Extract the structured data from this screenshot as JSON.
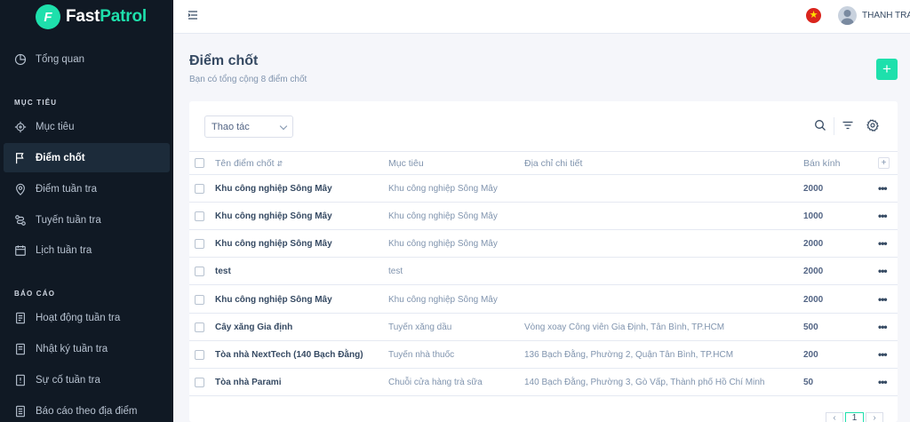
{
  "brand": {
    "name_part1": "Fast",
    "name_part2": "Patrol",
    "logo_letter": "F"
  },
  "sidebar": {
    "items": [
      {
        "label": "Tổng quan",
        "icon": "pie-chart-icon"
      },
      {
        "label": "Mục tiêu",
        "icon": "target-icon"
      },
      {
        "label": "Điểm chốt",
        "icon": "flag-icon",
        "active": true
      },
      {
        "label": "Điểm tuần tra",
        "icon": "map-pin-icon"
      },
      {
        "label": "Tuyến tuần tra",
        "icon": "route-icon"
      },
      {
        "label": "Lịch tuần tra",
        "icon": "calendar-icon"
      },
      {
        "label": "Hoạt động tuần tra",
        "icon": "report-icon"
      },
      {
        "label": "Nhật ký tuần tra",
        "icon": "journal-icon"
      },
      {
        "label": "Sự cố tuần tra",
        "icon": "incident-icon"
      },
      {
        "label": "Báo cáo theo địa điểm",
        "icon": "location-report-icon"
      }
    ],
    "headers": {
      "targets": "MỤC TIÊU",
      "reports": "BÁO CÁO"
    }
  },
  "topbar": {
    "user_name": "THANH TRA",
    "flag_icon": "vietnam-flag-icon",
    "flag_star": "★"
  },
  "page": {
    "title": "Điểm chốt",
    "subtitle": "Bạn có tổng cộng 8 điểm chốt",
    "add_label": "+"
  },
  "toolbar": {
    "action_select": "Thao tác"
  },
  "table": {
    "headers": {
      "name": "Tên điểm chốt",
      "target": "Mục tiêu",
      "address": "Địa chỉ chi tiết",
      "radius": "Bán kính",
      "add_col": "+"
    },
    "rows": [
      {
        "name": "Khu công nghiệp Sông Mây",
        "target": "Khu công nghiệp Sông Mây",
        "address": "",
        "radius": "2000"
      },
      {
        "name": "Khu công nghiệp Sông Mây",
        "target": "Khu công nghiệp Sông Mây",
        "address": "",
        "radius": "1000"
      },
      {
        "name": "Khu công nghiệp Sông Mây",
        "target": "Khu công nghiệp Sông Mây",
        "address": "",
        "radius": "2000"
      },
      {
        "name": "test",
        "target": "test",
        "address": "",
        "radius": "2000"
      },
      {
        "name": "Khu công nghiệp Sông Mây",
        "target": "Khu công nghiệp Sông Mây",
        "address": "",
        "radius": "2000"
      },
      {
        "name": "Cây xăng Gia định",
        "target": "Tuyến xăng dầu",
        "address": "Vòng xoay Công viên Gia Định, Tân Bình, TP.HCM",
        "radius": "500"
      },
      {
        "name": "Tòa nhà NextTech (140 Bạch Đằng)",
        "target": "Tuyến nhà thuốc",
        "address": "136 Bạch Đằng, Phường 2, Quận Tân Bình, TP.HCM",
        "radius": "200"
      },
      {
        "name": "Tòa nhà Parami",
        "target": "Chuỗi cửa hàng trà sữa",
        "address": "140 Bạch Đằng, Phường 3, Gò Vấp, Thành phố Hồ Chí Minh",
        "radius": "50"
      }
    ],
    "more_label": "•••"
  },
  "pagination": {
    "prev": "‹",
    "current": "1",
    "next": "›"
  },
  "colors": {
    "accent": "#1ee0ac",
    "sidebar_bg": "#101924",
    "text": "#364a63",
    "muted": "#8094ae"
  }
}
